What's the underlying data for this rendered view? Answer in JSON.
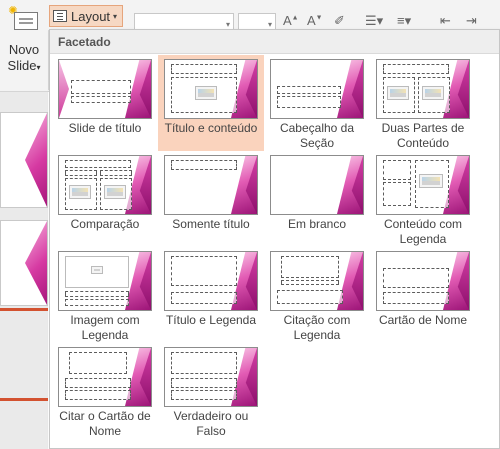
{
  "ribbon": {
    "new_slide_line1": "Novo",
    "new_slide_line2": "Slide",
    "new_slide_caret": "▾",
    "layout_label": "Layout",
    "layout_caret": "▾",
    "icons": [
      "new-slide-icon",
      "layout-icon",
      "font-size-increase-icon",
      "font-size-decrease-icon",
      "clear-formatting-icon",
      "bullets-icon",
      "decrease-indent-icon",
      "increase-indent-icon"
    ]
  },
  "gallery": {
    "header": "Facetado",
    "selected_index": 1,
    "items": [
      {
        "label": "Slide de título"
      },
      {
        "label": "Título e conteúdo"
      },
      {
        "label": "Cabeçalho da Seção"
      },
      {
        "label": "Duas Partes de Conteúdo"
      },
      {
        "label": "Comparação"
      },
      {
        "label": "Somente título"
      },
      {
        "label": "Em branco"
      },
      {
        "label": "Conteúdo com Legenda"
      },
      {
        "label": "Imagem com Legenda"
      },
      {
        "label": "Título e Legenda"
      },
      {
        "label": "Citação com Legenda"
      },
      {
        "label": "Cartão de Nome"
      },
      {
        "label": "Citar o Cartão de Nome"
      },
      {
        "label": "Verdadeiro ou Falso"
      }
    ]
  },
  "colors": {
    "accent": "#d35230",
    "selection": "#fad3bd",
    "theme_magenta": "#d63aa2"
  }
}
